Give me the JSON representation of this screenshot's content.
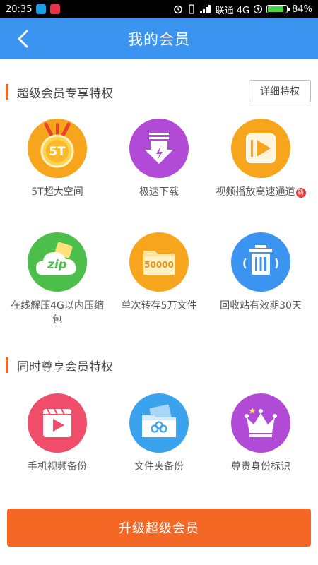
{
  "status_bar": {
    "time": "20:35",
    "carrier": "联通 4G",
    "battery_percent": "84%",
    "battery_level": 0.84
  },
  "header": {
    "title": "我的会员",
    "back_icon": "chevron-left-icon"
  },
  "section1": {
    "title": "超级会员专享特权",
    "detail_button": "详细特权",
    "features": [
      {
        "label": "5T超大空间",
        "icon": "5t-storage-icon",
        "badge_text": "5T",
        "color": "#f7a51d"
      },
      {
        "label": "极速下载",
        "icon": "download-icon",
        "color": "#b24ad8"
      },
      {
        "label": "视频播放高速通道",
        "icon": "video-play-icon",
        "new_badge": "新",
        "color": "#f7a51d"
      },
      {
        "label": "在线解压4G以内压缩包",
        "icon": "zip-icon",
        "badge_text": "zip",
        "color": "#4cbe4a"
      },
      {
        "label": "单次转存5万文件",
        "icon": "folder-icon",
        "badge_text": "50000",
        "color": "#f7a51d"
      },
      {
        "label": "回收站有效期30天",
        "icon": "trash-icon",
        "color": "#3b95f0"
      }
    ]
  },
  "section2": {
    "title": "同时尊享会员特权",
    "features": [
      {
        "label": "手机视频备份",
        "icon": "film-icon",
        "color": "#ef4d6a"
      },
      {
        "label": "文件夹备份",
        "icon": "folder-backup-icon",
        "color": "#3ba3ee"
      },
      {
        "label": "尊贵身份标识",
        "icon": "crown-icon",
        "color": "#b24ad8"
      }
    ]
  },
  "cta": {
    "label": "升级超级会员"
  }
}
